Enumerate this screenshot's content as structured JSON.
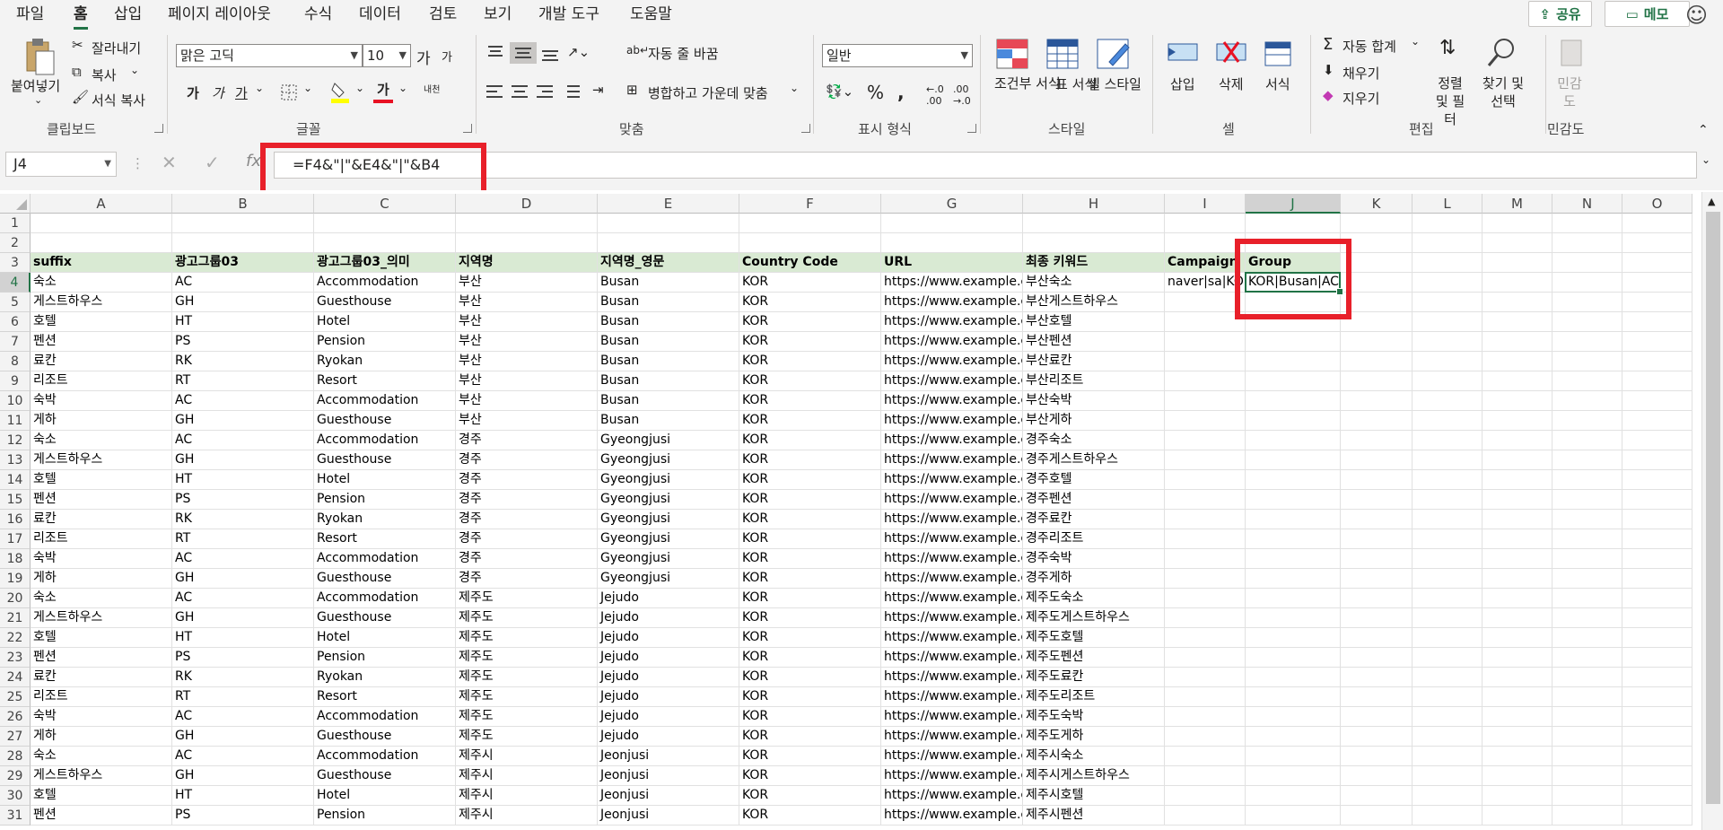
{
  "menu": {
    "tabs": [
      "파일",
      "홈",
      "삽입",
      "페이지 레이아웃",
      "수식",
      "데이터",
      "검토",
      "보기",
      "개발 도구",
      "도움말"
    ],
    "share": "공유",
    "memo": "메모"
  },
  "ribbon": {
    "clipboard": {
      "paste": "붙여넣기",
      "cut": "잘라내기",
      "copy": "복사",
      "format_painter": "서식 복사",
      "label": "클립보드"
    },
    "font": {
      "name": "맑은 고딕",
      "size": "10",
      "grow": "가",
      "shrink": "가",
      "bold": "가",
      "italic": "가",
      "underline": "가",
      "color_a": "가",
      "phonetic": "내천",
      "label": "글꼴"
    },
    "alignment": {
      "wrap_text": "자동 줄 바꿈",
      "merge_center": "병합하고 가운데 맞춤",
      "label": "맞춤"
    },
    "number": {
      "format": "일반",
      "label": "표시 형식"
    },
    "styles": {
      "conditional": "조건부 서식",
      "table": "표 서식",
      "cell_styles": "셀 스타일",
      "label": "스타일"
    },
    "cells": {
      "insert": "삽입",
      "delete": "삭제",
      "format": "서식",
      "label": "셀"
    },
    "editing": {
      "autosum": "자동 합계",
      "fill": "채우기",
      "clear": "지우기",
      "sort_filter": "정렬 및 필터",
      "find_select": "찾기 및 선택",
      "label": "편집"
    },
    "sensitivity": {
      "btn": "민감도",
      "label": "민감도"
    }
  },
  "formula_bar": {
    "name_box": "J4",
    "formula": "=F4&\"|\"&E4&\"|\"&B4"
  },
  "sheet": {
    "columns": [
      "A",
      "B",
      "C",
      "D",
      "E",
      "F",
      "G",
      "H",
      "I",
      "J",
      "K",
      "L",
      "M",
      "N",
      "O"
    ],
    "header_row": [
      "suffix",
      "광고그룹03",
      "광고그룹03_의미",
      "지역명",
      "지역명_영문",
      "Country Code",
      "URL",
      "최종 키워드",
      "Campaign",
      "Group"
    ],
    "rows": [
      [
        "숙소",
        "AC",
        "Accommodation",
        "부산",
        "Busan",
        "KOR",
        "https://www.example.co.kr",
        "부산숙소",
        "naver|sa|KOR",
        "KOR|Busan|AC"
      ],
      [
        "게스트하우스",
        "GH",
        "Guesthouse",
        "부산",
        "Busan",
        "KOR",
        "https://www.example.co.kr",
        "부산게스트하우스",
        "",
        ""
      ],
      [
        "호텔",
        "HT",
        "Hotel",
        "부산",
        "Busan",
        "KOR",
        "https://www.example.co.kr",
        "부산호텔",
        "",
        ""
      ],
      [
        "펜션",
        "PS",
        "Pension",
        "부산",
        "Busan",
        "KOR",
        "https://www.example.co.kr",
        "부산펜션",
        "",
        ""
      ],
      [
        "료칸",
        "RK",
        "Ryokan",
        "부산",
        "Busan",
        "KOR",
        "https://www.example.co.kr",
        "부산료칸",
        "",
        ""
      ],
      [
        "리조트",
        "RT",
        "Resort",
        "부산",
        "Busan",
        "KOR",
        "https://www.example.co.kr",
        "부산리조트",
        "",
        ""
      ],
      [
        "숙박",
        "AC",
        "Accommodation",
        "부산",
        "Busan",
        "KOR",
        "https://www.example.co.kr",
        "부산숙박",
        "",
        ""
      ],
      [
        "게하",
        "GH",
        "Guesthouse",
        "부산",
        "Busan",
        "KOR",
        "https://www.example.co.kr",
        "부산게하",
        "",
        ""
      ],
      [
        "숙소",
        "AC",
        "Accommodation",
        "경주",
        "Gyeongjusi",
        "KOR",
        "https://www.example.co.kr",
        "경주숙소",
        "",
        ""
      ],
      [
        "게스트하우스",
        "GH",
        "Guesthouse",
        "경주",
        "Gyeongjusi",
        "KOR",
        "https://www.example.co.kr",
        "경주게스트하우스",
        "",
        ""
      ],
      [
        "호텔",
        "HT",
        "Hotel",
        "경주",
        "Gyeongjusi",
        "KOR",
        "https://www.example.co.kr",
        "경주호텔",
        "",
        ""
      ],
      [
        "펜션",
        "PS",
        "Pension",
        "경주",
        "Gyeongjusi",
        "KOR",
        "https://www.example.co.kr",
        "경주펜션",
        "",
        ""
      ],
      [
        "료칸",
        "RK",
        "Ryokan",
        "경주",
        "Gyeongjusi",
        "KOR",
        "https://www.example.co.kr",
        "경주료칸",
        "",
        ""
      ],
      [
        "리조트",
        "RT",
        "Resort",
        "경주",
        "Gyeongjusi",
        "KOR",
        "https://www.example.co.kr",
        "경주리조트",
        "",
        ""
      ],
      [
        "숙박",
        "AC",
        "Accommodation",
        "경주",
        "Gyeongjusi",
        "KOR",
        "https://www.example.co.kr",
        "경주숙박",
        "",
        ""
      ],
      [
        "게하",
        "GH",
        "Guesthouse",
        "경주",
        "Gyeongjusi",
        "KOR",
        "https://www.example.co.kr",
        "경주게하",
        "",
        ""
      ],
      [
        "숙소",
        "AC",
        "Accommodation",
        "제주도",
        "Jejudo",
        "KOR",
        "https://www.example.co.kr",
        "제주도숙소",
        "",
        ""
      ],
      [
        "게스트하우스",
        "GH",
        "Guesthouse",
        "제주도",
        "Jejudo",
        "KOR",
        "https://www.example.co.kr",
        "제주도게스트하우스",
        "",
        ""
      ],
      [
        "호텔",
        "HT",
        "Hotel",
        "제주도",
        "Jejudo",
        "KOR",
        "https://www.example.co.kr",
        "제주도호텔",
        "",
        ""
      ],
      [
        "펜션",
        "PS",
        "Pension",
        "제주도",
        "Jejudo",
        "KOR",
        "https://www.example.co.kr",
        "제주도펜션",
        "",
        ""
      ],
      [
        "료칸",
        "RK",
        "Ryokan",
        "제주도",
        "Jejudo",
        "KOR",
        "https://www.example.co.kr",
        "제주도료칸",
        "",
        ""
      ],
      [
        "리조트",
        "RT",
        "Resort",
        "제주도",
        "Jejudo",
        "KOR",
        "https://www.example.co.kr",
        "제주도리조트",
        "",
        ""
      ],
      [
        "숙박",
        "AC",
        "Accommodation",
        "제주도",
        "Jejudo",
        "KOR",
        "https://www.example.co.kr",
        "제주도숙박",
        "",
        ""
      ],
      [
        "게하",
        "GH",
        "Guesthouse",
        "제주도",
        "Jejudo",
        "KOR",
        "https://www.example.co.kr",
        "제주도게하",
        "",
        ""
      ],
      [
        "숙소",
        "AC",
        "Accommodation",
        "제주시",
        "Jeonjusi",
        "KOR",
        "https://www.example.co.kr",
        "제주시숙소",
        "",
        ""
      ],
      [
        "게스트하우스",
        "GH",
        "Guesthouse",
        "제주시",
        "Jeonjusi",
        "KOR",
        "https://www.example.co.kr",
        "제주시게스트하우스",
        "",
        ""
      ],
      [
        "호텔",
        "HT",
        "Hotel",
        "제주시",
        "Jeonjusi",
        "KOR",
        "https://www.example.co.kr",
        "제주시호텔",
        "",
        ""
      ],
      [
        "펜션",
        "PS",
        "Pension",
        "제주시",
        "Jeonjusi",
        "KOR",
        "https://www.example.co.kr",
        "제주시펜션",
        "",
        ""
      ]
    ],
    "row_numbers": [
      "1",
      "2",
      "3",
      "4",
      "5",
      "6",
      "7",
      "8",
      "9",
      "10",
      "11",
      "12",
      "13",
      "14",
      "15",
      "16",
      "17",
      "18",
      "19",
      "20",
      "21",
      "22",
      "23",
      "24",
      "25",
      "26",
      "27",
      "28",
      "29",
      "30",
      "31"
    ],
    "selected_cell": "J4",
    "accent": "#217346",
    "highlight": "#e8202a",
    "header_fill": "#d9ead3"
  }
}
